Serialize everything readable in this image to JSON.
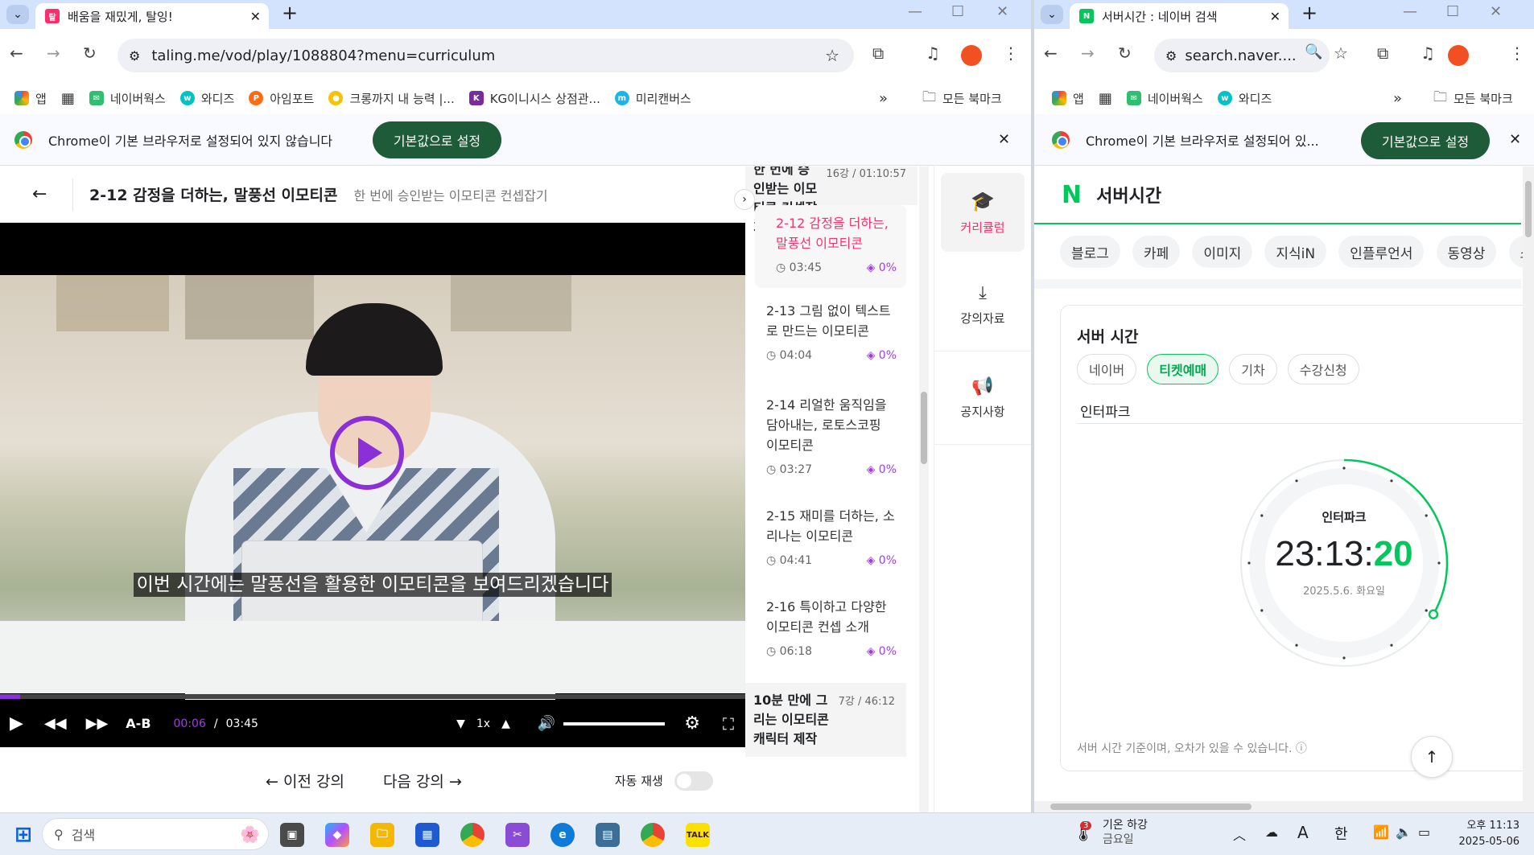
{
  "left_window": {
    "tab": {
      "title": "배움을 재밌게, 탈잉!",
      "favicon": "taling-icon"
    },
    "address": "taling.me/vod/play/1088804?menu=curriculum",
    "bookmarks": [
      "앱",
      "네이버웍스",
      "와디즈",
      "아임포트",
      "크롱까지 내 능력 |...",
      "KG이니시스 상점관...",
      "미리캔버스"
    ],
    "bookmarks_more": "»",
    "all_bookmarks": "모든 북마크",
    "infobar": {
      "message": "Chrome이 기본 브라우저로 설정되어 있지 않습니다",
      "button": "기본값으로 설정"
    },
    "lecture": {
      "title": "2-12 감정을 더하는, 말풍선 이모티콘",
      "course": "한 번에 승인받는 이모티콘 컨셉잡기"
    },
    "video": {
      "subtitle": "이번 시간에는 말풍선을 활용한 이모티콘을 보여드리겠습니다",
      "ab_label": "A-B",
      "current_time": "00:06",
      "separator": "/",
      "duration": "03:45",
      "speed": "1x",
      "progress": 0.027,
      "volume": 1.0,
      "colors": {
        "accent": "#8b2fd6"
      }
    },
    "nav": {
      "prev": "이전 강의",
      "next": "다음 강의",
      "autoplay": "자동 재생"
    },
    "curriculum": {
      "section": {
        "title": "한 번에 승인받는 이모티콘 컨셉잡기",
        "meta": "16강 / 01:10:57"
      },
      "lectures": [
        {
          "title": "2-12 감정을 더하는, 말풍선 이모티콘",
          "time": "03:45",
          "pct": "0%",
          "active": true
        },
        {
          "title": "2-13 그림 없이 텍스트로 만드는 이모티콘",
          "time": "04:04",
          "pct": "0%"
        },
        {
          "title": "2-14 리얼한 움직임을 담아내는, 로토스코핑 이모티콘",
          "time": "03:27",
          "pct": "0%"
        },
        {
          "title": "2-15 재미를 더하는, 소리나는 이모티콘",
          "time": "04:41",
          "pct": "0%"
        },
        {
          "title": "2-16 특이하고 다양한 이모티콘 컨셉 소개",
          "time": "06:18",
          "pct": "0%"
        }
      ],
      "next_section": {
        "title": "10분 만에 그리는 이모티콘 캐릭터 제작",
        "meta": "7강 / 46:12"
      }
    },
    "side_menu": {
      "curriculum": "커리큘럼",
      "materials": "강의자료",
      "notice": "공지사항"
    }
  },
  "right_window": {
    "tab": {
      "title": "서버시간 : 네이버 검색",
      "favicon": "naver-icon"
    },
    "address": "search.naver....",
    "bookmarks": [
      "앱",
      "네이버웍스",
      "와디즈"
    ],
    "bookmarks_more": "»",
    "all_bookmarks": "모든 북마크",
    "infobar": {
      "message": "Chrome이 기본 브라우저로 설정되어 있...",
      "button": "기본값으로 설정"
    },
    "naver_logo": "N",
    "query": "서버시간",
    "search_tabs": [
      "블로그",
      "카페",
      "이미지",
      "지식iN",
      "인플루언서",
      "동영상",
      "쇼핑"
    ],
    "card": {
      "title": "서버 시간",
      "filters": [
        "네이버",
        "티켓예매",
        "기차",
        "수강신청"
      ],
      "selected_filter": "티켓예매",
      "site": "인터파크",
      "clock_label": "인터파크",
      "time_hm": "23:13:",
      "time_s": "20",
      "date": "2025.5.6. 화요일",
      "note": "서버 시간 기준이며, 오차가 있을 수 있습니다.",
      "seconds_fraction": 0.333,
      "colors": {
        "accent": "#03c75a"
      }
    }
  },
  "taskbar": {
    "search_placeholder": "검색",
    "weather": {
      "badge": "3",
      "title": "기온 하강",
      "subtitle": "금요일"
    },
    "ime_a": "A",
    "ime_lang": "한",
    "clock_time": "오후 11:13",
    "clock_date": "2025-05-06"
  }
}
